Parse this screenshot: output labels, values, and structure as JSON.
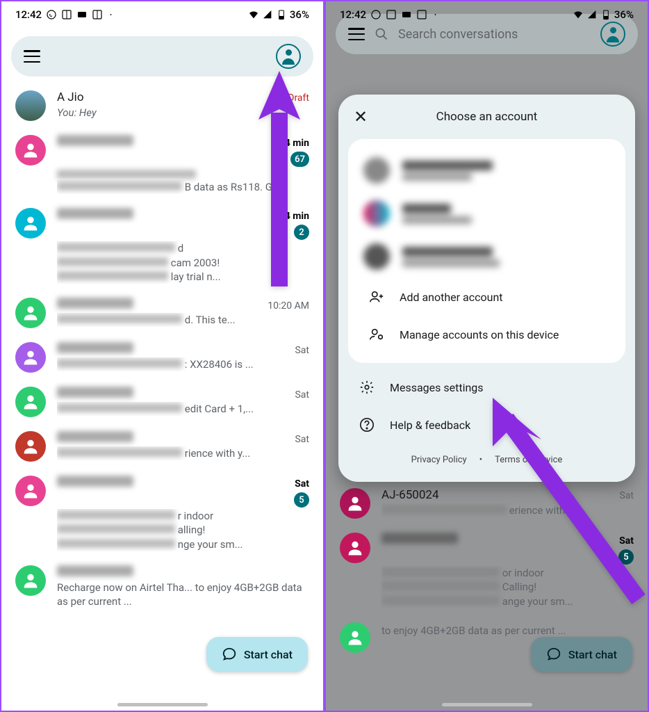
{
  "status": {
    "time": "12:42",
    "battery": "36%"
  },
  "search_placeholder": "Search conversations",
  "left": {
    "conversations": [
      {
        "name": "A Jio",
        "preview": "You: Hey",
        "time": "Draft",
        "avatar": "img"
      },
      {
        "name_blur": true,
        "preview_suffix": "",
        "time": "4 min",
        "badge": "67",
        "avatar_color": "#e84393",
        "bold": true
      },
      {
        "name_blur": true,
        "preview_suffix": "B data as Rs118. Ge...",
        "time": "",
        "avatar_color": null
      },
      {
        "name_blur": true,
        "preview_suffix": "d\ncam 2003!\nlay trial n...",
        "time": "4 min",
        "badge": "2",
        "avatar_color": "#00b8d4",
        "bold": true
      },
      {
        "name_blur": true,
        "preview_suffix": "d. This te...",
        "time": "10:20 AM",
        "avatar_color": "#2ecc71"
      },
      {
        "name_blur": true,
        "preview_suffix": ": XX28406 is ...",
        "time": "Sat",
        "avatar_color": "#a55eea"
      },
      {
        "name_blur": true,
        "preview_suffix": "edit Card + 1,...",
        "time": "Sat",
        "avatar_color": "#2ecc71"
      },
      {
        "name_blur": true,
        "preview_suffix": "rience with y...",
        "time": "Sat",
        "avatar_color": "#c0392b"
      },
      {
        "name_blur": true,
        "preview_suffix": "r indoor\nalling!\nnge your sm...",
        "time": "Sat",
        "badge": "5",
        "avatar_color": "#e84393",
        "bold": true
      },
      {
        "name_blur": true,
        "preview_full": "Recharge now on Airtel Tha... to enjoy 4GB+2GB data as per current ...",
        "time": "",
        "avatar_color": "#2ecc71"
      }
    ]
  },
  "right": {
    "sheet": {
      "title": "Choose an account",
      "add_another": "Add another account",
      "manage": "Manage accounts on this device",
      "settings": "Messages settings",
      "help": "Help & feedback",
      "privacy": "Privacy Policy",
      "terms": "Terms of Service"
    },
    "visible_convo": {
      "name": "AJ-650024",
      "preview_suffix": "erience with y...",
      "time": "Sat",
      "avatar_color": "#ad1457"
    },
    "convo2": {
      "preview_suffix": "or indoor\nCalling!\nange your sm...",
      "time": "Sat",
      "badge": "5",
      "avatar_color": "#c2185b"
    },
    "convo3": {
      "preview": "to enjoy 4GB+2GB data as per current ...",
      "avatar_color": "#2ecc71"
    }
  },
  "fab": "Start chat"
}
